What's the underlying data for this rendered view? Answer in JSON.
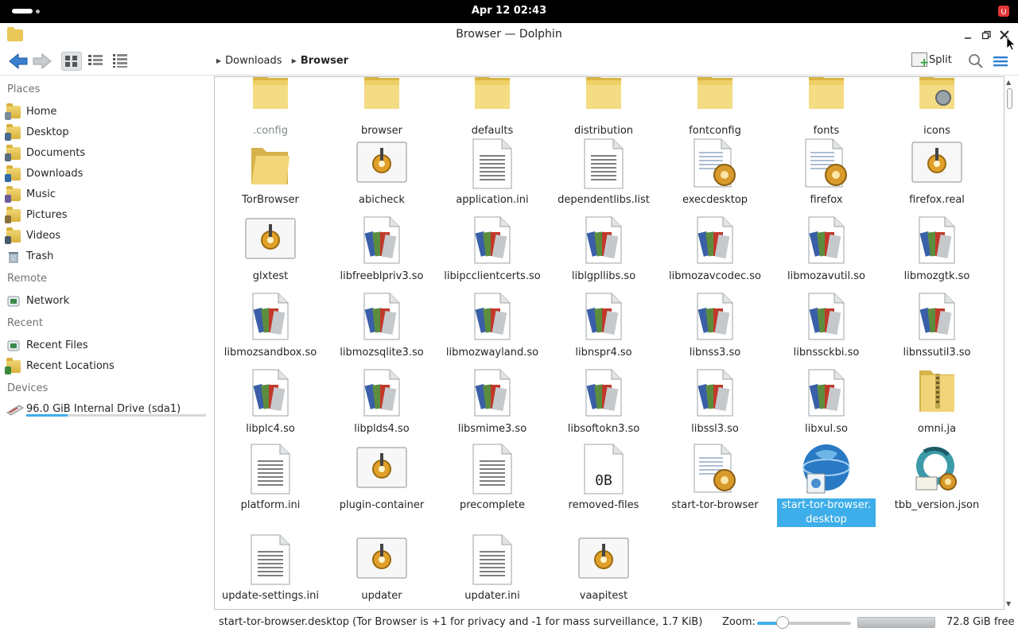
{
  "topbar": {
    "clock": "Apr 12  02:43"
  },
  "window": {
    "title": "Browser — Dolphin"
  },
  "toolbar": {
    "breadcrumb": [
      "Downloads",
      "Browser"
    ],
    "split_label": "Split"
  },
  "sidebar": {
    "sections": [
      {
        "label": "Places",
        "items": [
          "Home",
          "Desktop",
          "Documents",
          "Downloads",
          "Music",
          "Pictures",
          "Videos",
          "Trash"
        ]
      },
      {
        "label": "Remote",
        "items": [
          "Network"
        ]
      },
      {
        "label": "Recent",
        "items": [
          "Recent Files",
          "Recent Locations"
        ]
      },
      {
        "label": "Devices",
        "items": [
          "96.0 GiB Internal Drive (sda1)"
        ]
      }
    ],
    "drive_usage_fraction": 0.23
  },
  "files": [
    {
      "name": ".config",
      "type": "folder",
      "faded": true
    },
    {
      "name": "browser",
      "type": "folder"
    },
    {
      "name": "defaults",
      "type": "folder"
    },
    {
      "name": "distribution",
      "type": "folder"
    },
    {
      "name": "fontconfig",
      "type": "folder"
    },
    {
      "name": "fonts",
      "type": "folder"
    },
    {
      "name": "icons",
      "type": "folder-icons"
    },
    {
      "name": "TorBrowser",
      "type": "folder-open"
    },
    {
      "name": "abicheck",
      "type": "executable"
    },
    {
      "name": "application.ini",
      "type": "text"
    },
    {
      "name": "dependentlibs.list",
      "type": "text"
    },
    {
      "name": "execdesktop",
      "type": "script"
    },
    {
      "name": "firefox",
      "type": "script"
    },
    {
      "name": "firefox.real",
      "type": "executable"
    },
    {
      "name": "glxtest",
      "type": "executable"
    },
    {
      "name": "libfreeblpriv3.so",
      "type": "library"
    },
    {
      "name": "libipcclientcerts.so",
      "type": "library"
    },
    {
      "name": "liblgpllibs.so",
      "type": "library"
    },
    {
      "name": "libmozavcodec.so",
      "type": "library"
    },
    {
      "name": "libmozavutil.so",
      "type": "library"
    },
    {
      "name": "libmozgtk.so",
      "type": "library"
    },
    {
      "name": "libmozsandbox.so",
      "type": "library"
    },
    {
      "name": "libmozsqlite3.so",
      "type": "library"
    },
    {
      "name": "libmozwayland.so",
      "type": "library"
    },
    {
      "name": "libnspr4.so",
      "type": "library"
    },
    {
      "name": "libnss3.so",
      "type": "library"
    },
    {
      "name": "libnssckbi.so",
      "type": "library"
    },
    {
      "name": "libnssutil3.so",
      "type": "library"
    },
    {
      "name": "libplc4.so",
      "type": "library"
    },
    {
      "name": "libplds4.so",
      "type": "library"
    },
    {
      "name": "libsmime3.so",
      "type": "library"
    },
    {
      "name": "libsoftokn3.so",
      "type": "library"
    },
    {
      "name": "libssl3.so",
      "type": "library"
    },
    {
      "name": "libxul.so",
      "type": "library"
    },
    {
      "name": "omni.ja",
      "type": "archive"
    },
    {
      "name": "platform.ini",
      "type": "text"
    },
    {
      "name": "plugin-container",
      "type": "executable"
    },
    {
      "name": "precomplete",
      "type": "text"
    },
    {
      "name": "removed-files",
      "type": "empty",
      "icon_text": "0B"
    },
    {
      "name": "start-tor-browser",
      "type": "script"
    },
    {
      "name": "start-tor-browser.\ndesktop",
      "type": "desktop",
      "selected": true
    },
    {
      "name": "tbb_version.json",
      "type": "json"
    },
    {
      "name": "update-settings.ini",
      "type": "text"
    },
    {
      "name": "updater",
      "type": "executable"
    },
    {
      "name": "updater.ini",
      "type": "text"
    },
    {
      "name": "vaapitest",
      "type": "executable"
    }
  ],
  "statusbar": {
    "status_text": "start-tor-browser.desktop (Tor Browser  is +1 for privacy and -1 for mass surveillance, 1.7 KiB)",
    "zoom_label": "Zoom:",
    "zoom_fraction": 0.3,
    "free_space": "72.8 GiB free"
  },
  "colors": {
    "accent": "#3daee9",
    "folder": "#e9c857",
    "topbar": "#000000"
  }
}
